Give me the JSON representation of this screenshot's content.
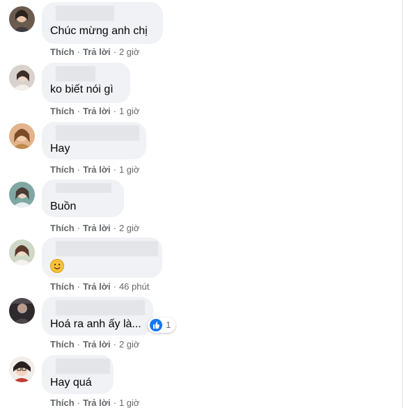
{
  "comments": [
    {
      "text": "Chúc mừng anh chị",
      "like": "Thích",
      "reply": "Trả lời",
      "time": "2 giờ"
    },
    {
      "text": "ko biết nói gì",
      "like": "Thích",
      "reply": "Trả lời",
      "time": "1 giờ"
    },
    {
      "text": "Hay",
      "like": "Thích",
      "reply": "Trả lời",
      "time": "1 giờ"
    },
    {
      "text": "Buồn",
      "like": "Thích",
      "reply": "Trả lời",
      "time": "2 giờ"
    },
    {
      "text": "",
      "emoji": "smile-emoji",
      "like": "Thích",
      "reply": "Trả lời",
      "time": "46 phút"
    },
    {
      "text": "Hoá ra anh ấy là...",
      "like": "Thích",
      "reply": "Trả lời",
      "time": "2 giờ",
      "reaction": {
        "icon": "like-icon",
        "count": "1"
      }
    },
    {
      "text": "Hay quá",
      "like": "Thích",
      "reply": "Trả lời",
      "time": "1 giờ"
    }
  ],
  "colors": {
    "bubble": "#f0f2f5",
    "meta": "#65676b",
    "text": "#050505",
    "like_blue": "#1877f2"
  }
}
